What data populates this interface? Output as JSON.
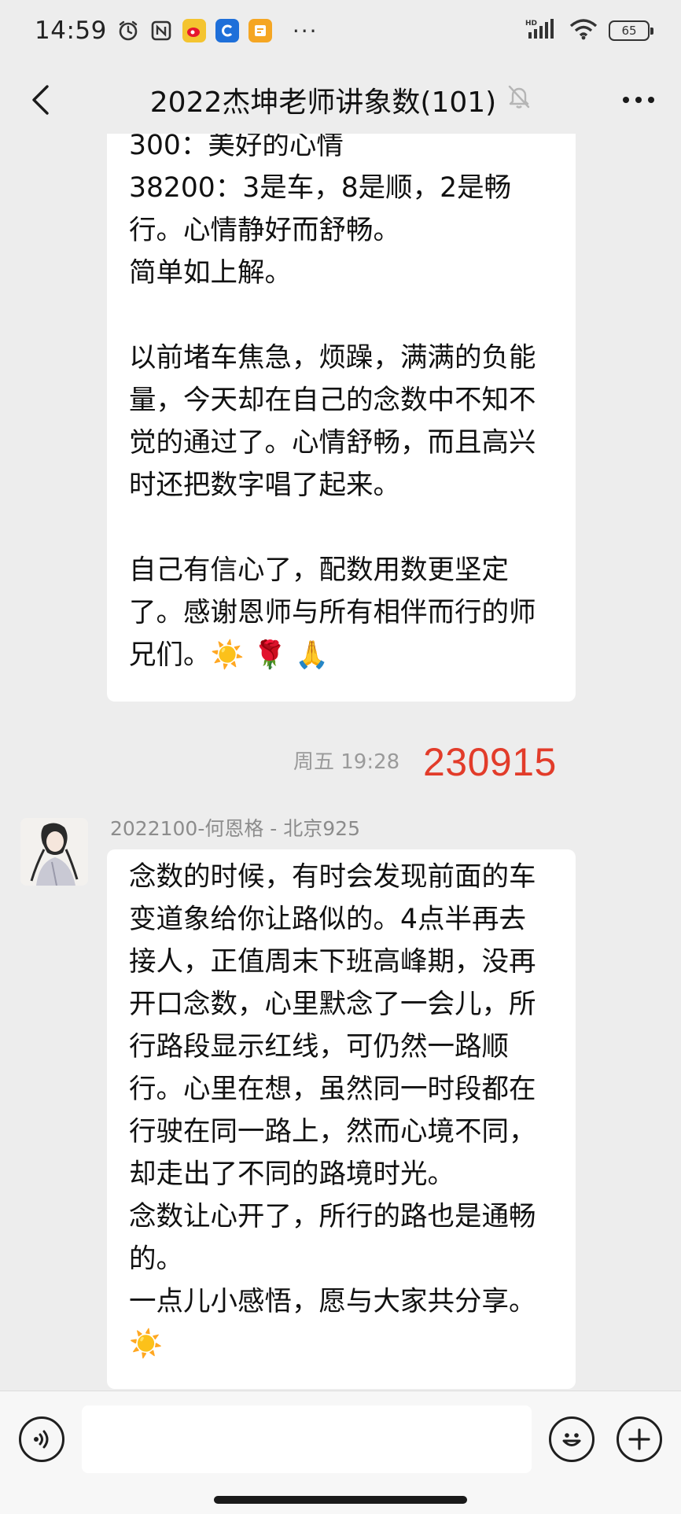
{
  "status_bar": {
    "time": "14:59",
    "battery": "65",
    "network": "HD",
    "icons": [
      "alarm-icon",
      "nfc-icon",
      "weibo-icon",
      "browser-icon",
      "note-icon"
    ],
    "more": "···"
  },
  "header": {
    "title": "2022杰坤老师讲象数(101)",
    "muted_icon": "bell-muted-icon"
  },
  "messages": [
    {
      "lines_a": [
        "300：美好的心情",
        "38200：3是车，8是顺，2是畅",
        "行。心情静好而舒畅。",
        "简单如上解。"
      ],
      "lines_b": [
        "以前堵车焦急，烦躁，满满的负能",
        "量，今天却在自己的念数中不知不",
        "觉的通过了。心情舒畅，而且高兴",
        "时还把数字唱了起来。"
      ],
      "lines_c": [
        "自己有信心了，配数用数更坚定",
        "了。感谢恩师与所有相伴而行的师",
        "兄们。"
      ],
      "emojis": [
        "☀️",
        "🌹",
        "🙏"
      ]
    }
  ],
  "timestamp": {
    "label": "周五 19:28",
    "red_stamp": "230915"
  },
  "message2": {
    "sender": "2022100-何恩格 - 北京925",
    "lines": [
      "念数的时候，有时会发现前面的车",
      "变道象给你让路似的。4点半再去",
      "接人，正值周末下班高峰期，没再",
      "开口念数，心里默念了一会儿，所",
      "行路段显示红线，可仍然一路顺",
      "行。心里在想，虽然同一时段都在",
      "行驶在同一路上，然而心境不同，",
      "却走出了不同的路境时光。",
      "念数让心开了，所行的路也是通畅",
      "的。",
      "一点儿小感悟，愿与大家共分享。"
    ],
    "emoji": "☀️"
  },
  "input_bar": {
    "voice_icon": "voice-icon",
    "emoji_icon": "emoji-icon",
    "plus_icon": "plus-icon",
    "placeholder": ""
  },
  "colors": {
    "background": "#ededed",
    "bubble": "#ffffff",
    "red_stamp": "#e23c2a",
    "meta_text": "#9a9a9a"
  }
}
